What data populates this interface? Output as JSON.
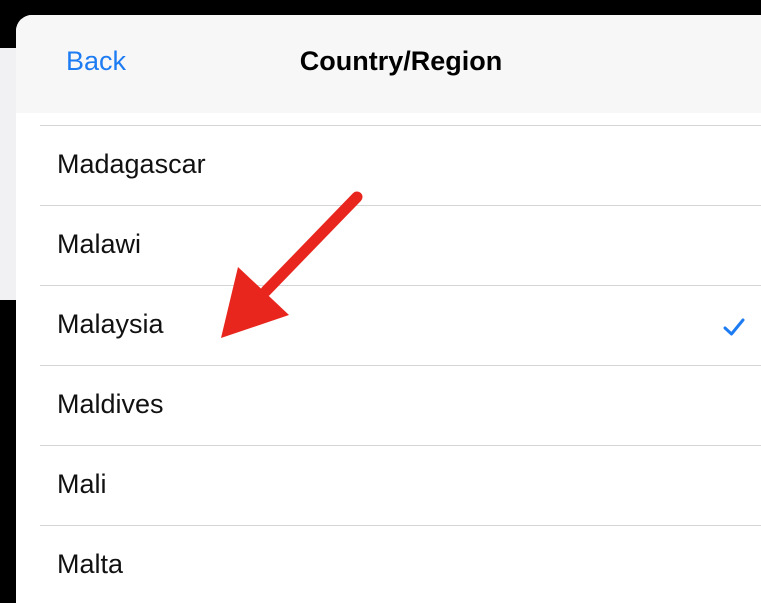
{
  "nav": {
    "back_label": "Back",
    "title": "Country/Region"
  },
  "countries": [
    {
      "label": "Madagascar",
      "selected": false
    },
    {
      "label": "Malawi",
      "selected": false
    },
    {
      "label": "Malaysia",
      "selected": true
    },
    {
      "label": "Maldives",
      "selected": false
    },
    {
      "label": "Mali",
      "selected": false
    },
    {
      "label": "Malta",
      "selected": false
    }
  ],
  "colors": {
    "accent": "#1e7cf3",
    "annotation_arrow": "#e8261d"
  },
  "icons": {
    "selected": "checkmark-icon",
    "annotation": "red-arrow-annotation"
  }
}
